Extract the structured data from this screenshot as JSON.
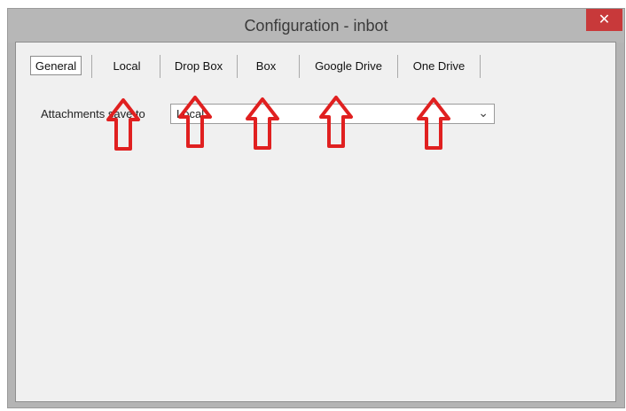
{
  "window": {
    "title": "Configuration - inbot",
    "close_glyph": "✕"
  },
  "tabs": [
    {
      "label": "General"
    },
    {
      "label": "Local"
    },
    {
      "label": "Drop Box"
    },
    {
      "label": "Box"
    },
    {
      "label": "Google Drive"
    },
    {
      "label": "One Drive"
    }
  ],
  "settings": {
    "attachments_label": "Attachments save to",
    "attachments_value": "Local",
    "dropdown_glyph": "⌄"
  },
  "annotations": {
    "arrow_color": "#e02020",
    "arrow_count": 5
  }
}
